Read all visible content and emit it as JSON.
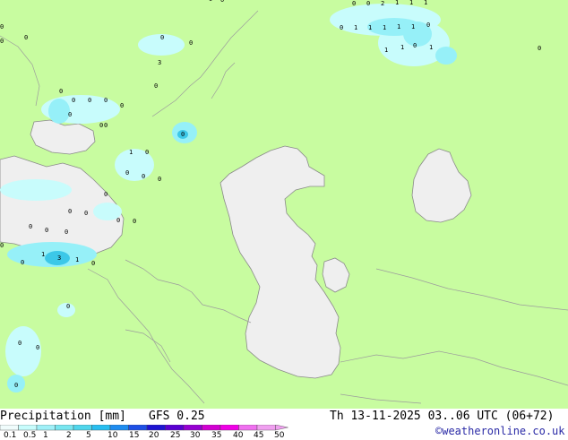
{
  "map": {
    "land_color": "#c8fca0",
    "water_color": "#efefef",
    "precip_colors": [
      "#c8fcfc",
      "#96f0f8",
      "#64dcf0",
      "#3cc8e8"
    ],
    "point_values": [
      "0",
      "0",
      "2",
      "1",
      "1",
      "1",
      "0",
      "1",
      "1",
      "1",
      "1",
      "1",
      "0",
      "1",
      "1",
      "0",
      "1",
      "0",
      "0",
      "0",
      "0",
      "0",
      "0",
      "0",
      "0",
      "0",
      "0",
      "0",
      "3",
      "0",
      "0",
      "1",
      "0",
      "0",
      "0",
      "0",
      "0",
      "0",
      "0",
      "0",
      "0",
      "0",
      "0",
      "0",
      "0",
      "1",
      "3",
      "1",
      "0",
      "0",
      "0",
      "0",
      "0",
      "0",
      "0",
      "0",
      "0",
      "0",
      "0"
    ]
  },
  "footer": {
    "title": "Precipitation [mm]",
    "model": "GFS 0.25",
    "valid_time": "Th 13-11-2025 03..06 UTC (06+72)",
    "credit": "©weatheronline.co.uk"
  },
  "legend": {
    "labels": [
      "0.1",
      "0.5",
      "1",
      "2",
      "5",
      "10",
      "15",
      "20",
      "25",
      "30",
      "35",
      "40",
      "45",
      "50"
    ],
    "colors": [
      "#f0fcfc",
      "#c8fcfc",
      "#a0f0f8",
      "#78e6f0",
      "#50d6ec",
      "#28bef0",
      "#1e8cf0",
      "#1e50e6",
      "#1e14d2",
      "#5a00d2",
      "#9600d2",
      "#d200d2",
      "#f000e6",
      "#f070f0",
      "#f0a0f0"
    ]
  }
}
